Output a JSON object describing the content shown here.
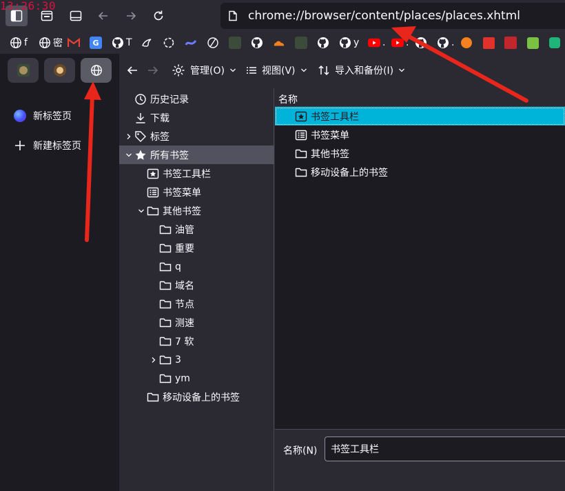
{
  "clock": "13:26:30",
  "urlbar": {
    "url": "chrome://browser/content/places/places.xhtml"
  },
  "bookmarks_bar": [
    {
      "label": "f",
      "icon": "globe-icon"
    },
    {
      "label": "密",
      "icon": "globe-icon"
    },
    {
      "label": "",
      "icon": "gmail-icon"
    },
    {
      "label": "",
      "icon": "translate-icon"
    },
    {
      "label": "T",
      "icon": "github-icon"
    },
    {
      "label": "",
      "icon": "bird-icon"
    },
    {
      "label": "",
      "icon": "openai-icon"
    },
    {
      "label": "",
      "icon": "wave-icon"
    },
    {
      "label": "",
      "icon": "slash-icon"
    },
    {
      "label": "",
      "icon": "game-icon"
    },
    {
      "label": "",
      "icon": "github-icon"
    },
    {
      "label": "",
      "icon": "cloud-icon"
    },
    {
      "label": "",
      "icon": "game-icon"
    },
    {
      "label": "",
      "icon": "github-icon"
    },
    {
      "label": "y",
      "icon": "github-icon"
    },
    {
      "label": ".",
      "icon": "youtube-icon"
    },
    {
      "label": ".",
      "icon": "youtube-icon"
    },
    {
      "label": "",
      "icon": "github-icon"
    },
    {
      "label": ".",
      "icon": "github-icon"
    },
    {
      "label": "",
      "icon": "orange-icon"
    },
    {
      "label": "",
      "icon": "red-square-icon"
    },
    {
      "label": "",
      "icon": "seal-icon"
    },
    {
      "label": "",
      "icon": "d-icon"
    },
    {
      "label": "",
      "icon": "green-icon"
    }
  ],
  "left_sidebar": {
    "items": [
      {
        "label": "新标签页",
        "icon": "firefox-icon"
      },
      {
        "label": "新建标签页",
        "icon": "plus-icon"
      }
    ]
  },
  "library_toolbar": {
    "manage": "管理(O)",
    "views": "视图(V)",
    "import_backup": "导入和备份(I)"
  },
  "tree": [
    {
      "label": "历史记录",
      "icon": "clock-icon"
    },
    {
      "label": "下载",
      "icon": "download-icon"
    },
    {
      "label": "标签",
      "icon": "tag-icon"
    },
    {
      "label": "所有书签",
      "icon": "star-icon"
    },
    {
      "label": "书签工具栏",
      "icon": "bookmark-toolbar-icon"
    },
    {
      "label": "书签菜单",
      "icon": "bookmark-menu-icon"
    },
    {
      "label": "其他书签",
      "icon": "folder-icon"
    },
    {
      "label": "油管",
      "icon": "folder-icon"
    },
    {
      "label": "重要",
      "icon": "folder-icon"
    },
    {
      "label": "q",
      "icon": "folder-icon"
    },
    {
      "label": "域名",
      "icon": "folder-icon"
    },
    {
      "label": "节点",
      "icon": "folder-icon"
    },
    {
      "label": "测速",
      "icon": "folder-icon"
    },
    {
      "label": "7 软",
      "icon": "folder-icon"
    },
    {
      "label": "3",
      "icon": "folder-icon"
    },
    {
      "label": "ym",
      "icon": "folder-icon"
    },
    {
      "label": "移动设备上的书签",
      "icon": "folder-icon"
    }
  ],
  "content": {
    "column_name": "名称",
    "rows": [
      {
        "label": "书签工具栏",
        "icon": "bookmark-toolbar-icon"
      },
      {
        "label": "书签菜单",
        "icon": "bookmark-menu-icon"
      },
      {
        "label": "其他书签",
        "icon": "folder-icon"
      },
      {
        "label": "移动设备上的书签",
        "icon": "folder-icon"
      }
    ]
  },
  "details": {
    "name_label": "名称(N)",
    "name_value": "书签工具栏"
  },
  "colors": {
    "selection": "#00b3d9",
    "arrow": "#e8261b",
    "clock": "#d8123f"
  }
}
